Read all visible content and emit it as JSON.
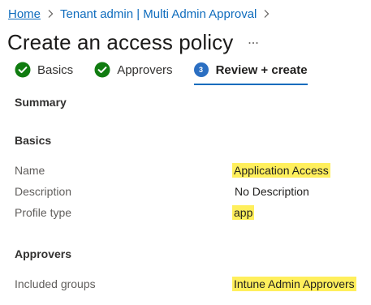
{
  "breadcrumb": {
    "items": [
      {
        "label": "Home"
      },
      {
        "label": "Tenant admin | Multi Admin Approval"
      }
    ]
  },
  "page": {
    "title": "Create an access policy",
    "more_label": "..."
  },
  "tabs": [
    {
      "label": "Basics",
      "state": "completed",
      "icon": "check-circle-icon"
    },
    {
      "label": "Approvers",
      "state": "completed",
      "icon": "check-circle-icon"
    },
    {
      "label": "Review + create",
      "state": "active",
      "step_number": "3"
    }
  ],
  "review": {
    "summary_heading": "Summary",
    "basics": {
      "heading": "Basics",
      "fields": [
        {
          "label": "Name",
          "value": "Application Access",
          "highlighted": true
        },
        {
          "label": "Description",
          "value": "No Description",
          "highlighted": false
        },
        {
          "label": "Profile type",
          "value": "app",
          "highlighted": true
        }
      ]
    },
    "approvers": {
      "heading": "Approvers",
      "fields": [
        {
          "label": "Included groups",
          "value": "Intune Admin Approvers",
          "highlighted": true
        }
      ]
    }
  },
  "colors": {
    "link": "#0f6cbd",
    "success": "#107c10",
    "step_active": "#2b6fc2",
    "highlight": "#ffef5c",
    "label_text": "#605e5c"
  }
}
